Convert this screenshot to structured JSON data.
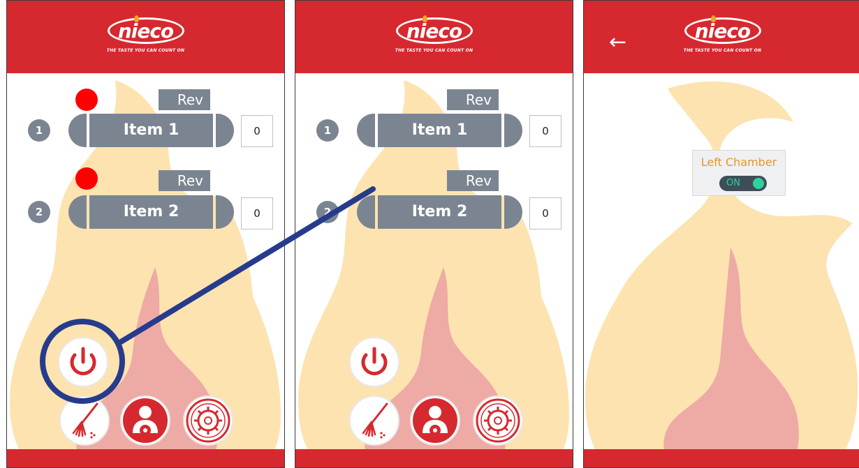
{
  "brand": {
    "name": "nieco",
    "tagline": "THE TASTE YOU CAN COUNT ON",
    "header_color": "#d6292f",
    "flame_outer": "#fde3b0",
    "flame_inner": "#eeaaa5"
  },
  "panel1": {
    "items": [
      {
        "number": "1",
        "label": "Item 1",
        "count": "0",
        "rev_label": "Rev"
      },
      {
        "number": "2",
        "label": "Item 2",
        "count": "0",
        "rev_label": "Rev"
      }
    ],
    "icons": {
      "power": "power-icon",
      "clean": "broom-icon",
      "user_settings": "user-gear-icon",
      "settings": "gear-icon"
    }
  },
  "panel2": {
    "items": [
      {
        "number": "1",
        "label": "Item 1",
        "count": "0",
        "rev_label": "Rev"
      },
      {
        "number": "2",
        "label": "Item 2",
        "count": "0",
        "rev_label": "Rev"
      }
    ]
  },
  "panel3": {
    "back_icon": "←",
    "chamber_label": "Left Chamber",
    "toggle_label": "ON",
    "toggle_color": "#2fd19c"
  },
  "annotation": {
    "circle_color": "#263b8c",
    "dot_color": "#ff0000"
  }
}
